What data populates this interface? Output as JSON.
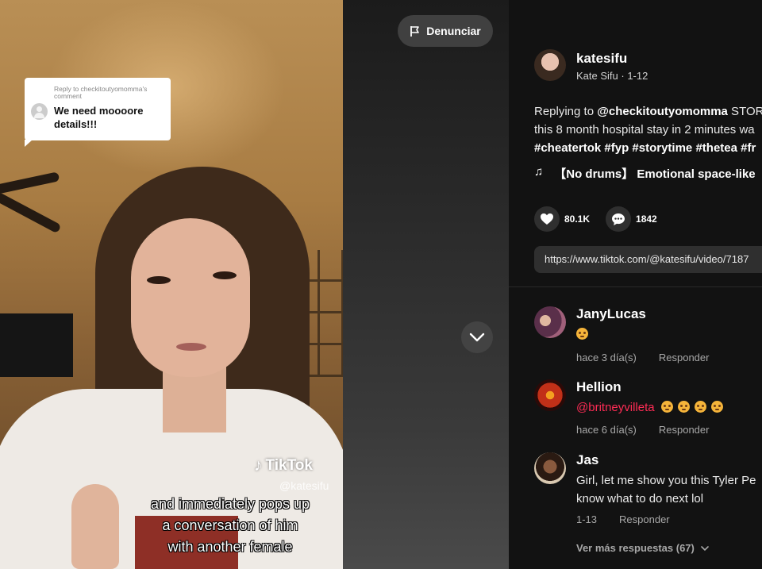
{
  "video": {
    "report_label": "Denunciar",
    "reply_bubble": {
      "header": "Reply to checkitoutyomomma's comment",
      "text": "We need moooore details!!!"
    },
    "watermark": {
      "logo_text": "TikTok",
      "handle": "@katesifu"
    },
    "caption_lines": [
      "and immediately pops up",
      "a conversation of him",
      "with another female"
    ]
  },
  "author": {
    "username": "katesifu",
    "display_name": "Kate Sifu",
    "date": "1-12",
    "separator": " · "
  },
  "description": {
    "prefix": "Replying to ",
    "mention": "@checkitoutyomomma",
    "line1_rest": " STOR",
    "line2": "this 8 month hospital stay in 2 minutes wa",
    "hashtags": [
      "#cheatertok",
      "#fyp",
      "#storytime",
      "#thetea",
      "#fr"
    ]
  },
  "music": {
    "icon": "music-note-icon",
    "title": "【No drums】 Emotional space-like"
  },
  "stats": {
    "likes": "80.1K",
    "comments": "1842"
  },
  "share_url": "https://www.tiktok.com/@katesifu/video/7187",
  "comments": [
    {
      "username": "JanyLucas",
      "text": "",
      "emoji_count": 1,
      "time": "hace 3 día(s)",
      "reply_label": "Responder",
      "avatar_color": "#7a4a6a"
    },
    {
      "username": "Hellion",
      "mention": "@britneyvilleta",
      "emoji_count": 4,
      "time": "hace 6 día(s)",
      "reply_label": "Responder",
      "avatar_color": "#b8321c"
    },
    {
      "username": "Jas",
      "text_line1": "Girl, let me show you this Tyler Pe",
      "text_line2": "know what to do next lol",
      "time": "1-13",
      "reply_label": "Responder",
      "avatar_color": "#5a3a28"
    }
  ],
  "more_replies": "Ver más respuestas (67)",
  "colors": {
    "background": "#121212",
    "accent_mention": "#fe2c55",
    "chip": "#2f2f2f"
  }
}
